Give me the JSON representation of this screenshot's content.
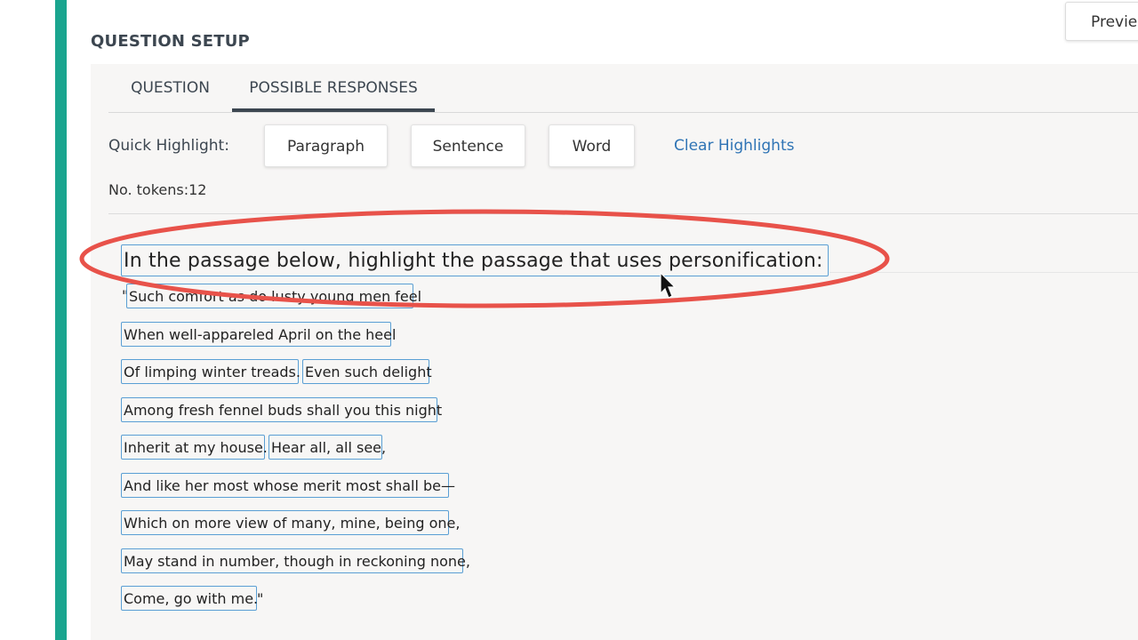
{
  "header": {
    "section_title": "QUESTION SETUP",
    "preview_label": "Preview"
  },
  "tabs": [
    {
      "label": "QUESTION",
      "active": false
    },
    {
      "label": "POSSIBLE RESPONSES",
      "active": true
    }
  ],
  "quick_highlight": {
    "label": "Quick Highlight:",
    "buttons": [
      "Paragraph",
      "Sentence",
      "Word"
    ],
    "clear_label": "Clear Highlights"
  },
  "tokens_info": {
    "label": "No. tokens:12"
  },
  "passage": {
    "prompt": "In the passage below, highlight the passage that uses personification:",
    "open_quote": "\"",
    "close_quote": "\"",
    "tokens": [
      "Such comfort as do lusty young men feel",
      "When well-appareled April on the heel",
      "Of limping winter treads.",
      "Even such delight",
      "Among fresh fennel buds shall you this night",
      "Inherit at my house.",
      "Hear all, all see,",
      "And like her most whose merit most shall be—",
      "Which on more view of many, mine, being one,",
      "May stand in number, though in reckoning none,",
      "Come, go with me."
    ]
  },
  "colors": {
    "accent_bar": "#1aa58f",
    "token_border": "#5a9fd4",
    "link": "#2f74b5",
    "annotation": "#e8524a"
  },
  "icons": [
    "mouse-cursor-icon"
  ]
}
